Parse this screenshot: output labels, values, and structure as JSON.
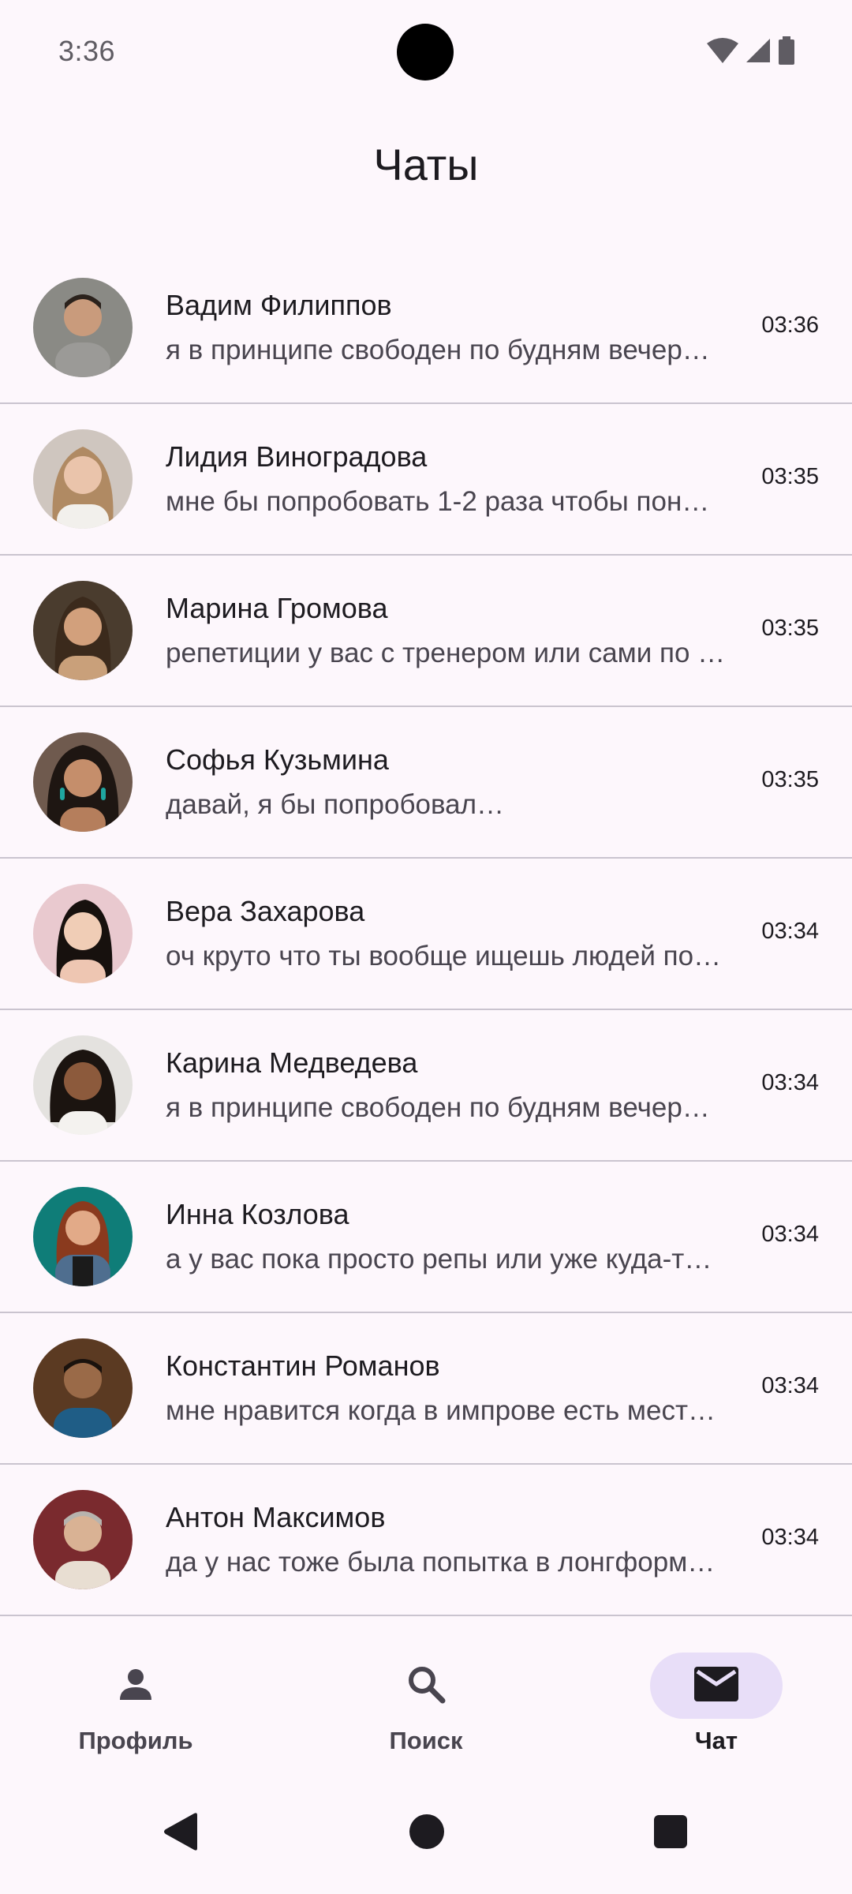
{
  "status_bar": {
    "time": "3:36",
    "icons": [
      "wifi-icon",
      "signal-icon",
      "battery-icon"
    ]
  },
  "header": {
    "title": "Чаты"
  },
  "chats": [
    {
      "name": "Вадим Филиппов",
      "preview": "я в принципе свободен по будням вечер…",
      "time": "03:36",
      "avatar_color": "#8a8a85"
    },
    {
      "name": "Лидия Виноградова",
      "preview": "мне бы попробовать 1-2 раза чтобы пон…",
      "time": "03:35",
      "avatar_color": "#cfc6bf"
    },
    {
      "name": "Марина Громова",
      "preview": "репетиции у вас с тренером или сами по …",
      "time": "03:35",
      "avatar_color": "#4a3c2e"
    },
    {
      "name": "Софья Кузьмина",
      "preview": "давай, я бы попробовал…",
      "time": "03:35",
      "avatar_color": "#6f5a4e"
    },
    {
      "name": "Вера Захарова",
      "preview": "оч круто что ты вообще ищешь людей по…",
      "time": "03:34",
      "avatar_color": "#e9c9cf"
    },
    {
      "name": "Карина Медведева",
      "preview": "я в принципе свободен по будням вечер…",
      "time": "03:34",
      "avatar_color": "#e4e2df"
    },
    {
      "name": "Инна Козлова",
      "preview": "а у вас пока просто репы или уже куда-т…",
      "time": "03:34",
      "avatar_color": "#0f7d78"
    },
    {
      "name": "Константин Романов",
      "preview": "мне нравится когда в импрове есть мест…",
      "time": "03:34",
      "avatar_color": "#5b3a22"
    },
    {
      "name": "Антон Максимов",
      "preview": "да у нас тоже была попытка в лонгформ…",
      "time": "03:34",
      "avatar_color": "#7a2a2e"
    }
  ],
  "bottom_nav": {
    "items": [
      {
        "label": "Профиль",
        "icon": "person-icon",
        "active": false
      },
      {
        "label": "Поиск",
        "icon": "search-icon",
        "active": false
      },
      {
        "label": "Чат",
        "icon": "mail-icon",
        "active": true
      }
    ]
  },
  "colors": {
    "background": "#fdf7fc",
    "active_indicator": "#e8def8",
    "divider": "#cac4cf"
  }
}
